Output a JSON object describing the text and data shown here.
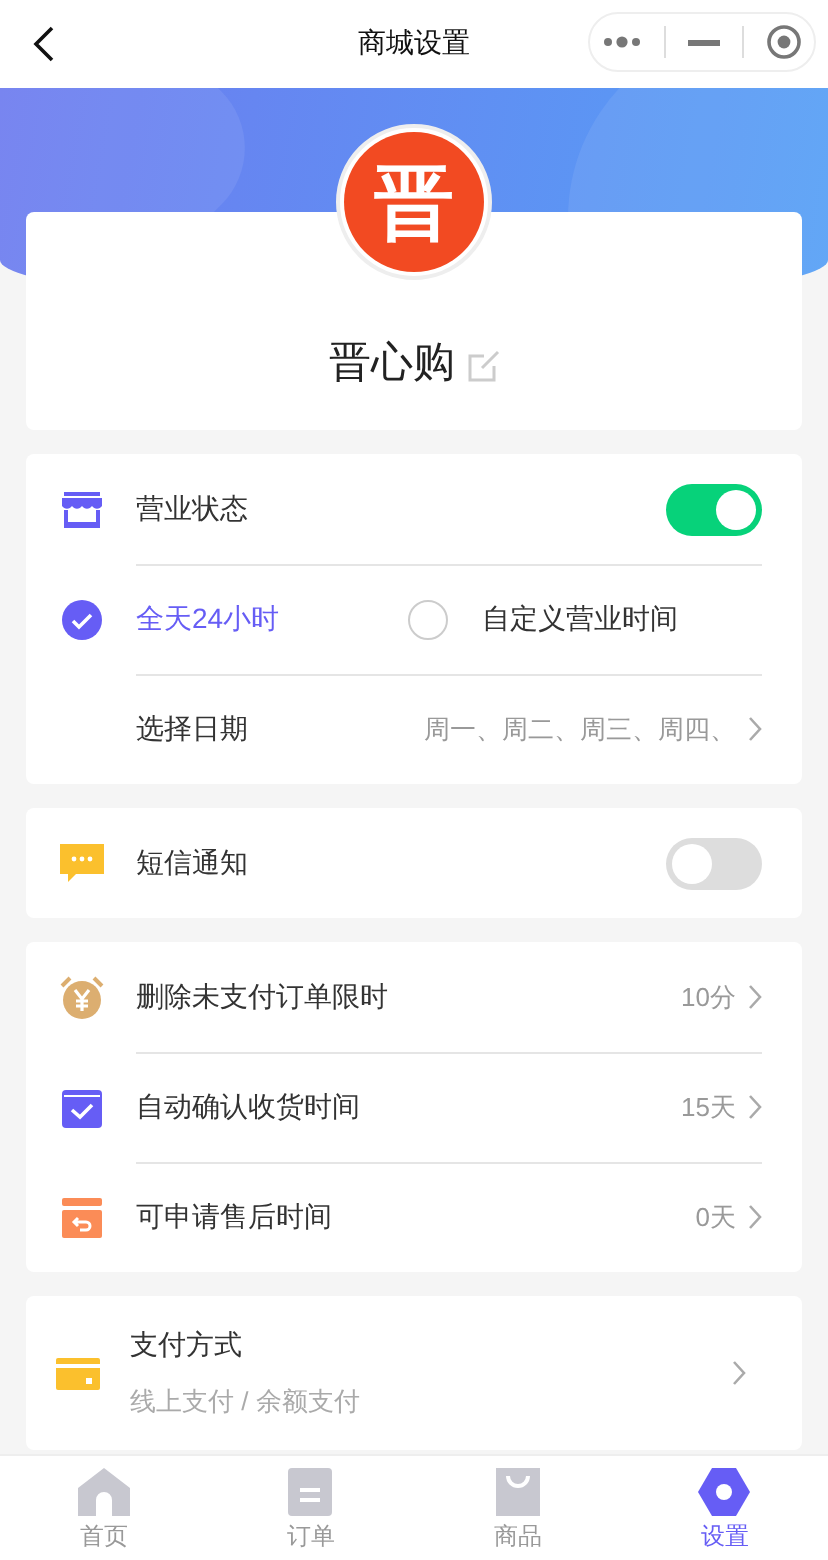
{
  "header": {
    "title": "商城设置"
  },
  "shop": {
    "avatar": "晋",
    "name": "晋心购"
  },
  "cards": [
    {
      "rows": [
        {
          "kind": "toggle",
          "label": "营业状态",
          "on": true
        },
        {
          "kind": "radio",
          "options": [
            {
              "label": "全天24小时",
              "selected": true
            },
            {
              "label": "自定义营业时间",
              "selected": false
            }
          ]
        },
        {
          "kind": "link",
          "label": "选择日期",
          "value": "周一、周二、周三、周四、"
        }
      ]
    },
    {
      "rows": [
        {
          "kind": "toggle",
          "label": "短信通知",
          "on": false
        }
      ]
    },
    {
      "rows": [
        {
          "kind": "link",
          "label": "删除未支付订单限时",
          "value": "10分"
        },
        {
          "kind": "link",
          "label": "自动确认收货时间",
          "value": "15天"
        },
        {
          "kind": "link",
          "label": "可申请售后时间",
          "value": "0天"
        }
      ]
    },
    {
      "rows": [
        {
          "kind": "detail",
          "label": "支付方式",
          "sub": "线上支付 / 余额支付"
        }
      ]
    }
  ],
  "tabs": [
    {
      "label": "首页",
      "selected": false
    },
    {
      "label": "订单",
      "selected": false
    },
    {
      "label": "商品",
      "selected": false
    },
    {
      "label": "设置",
      "selected": true
    }
  ]
}
